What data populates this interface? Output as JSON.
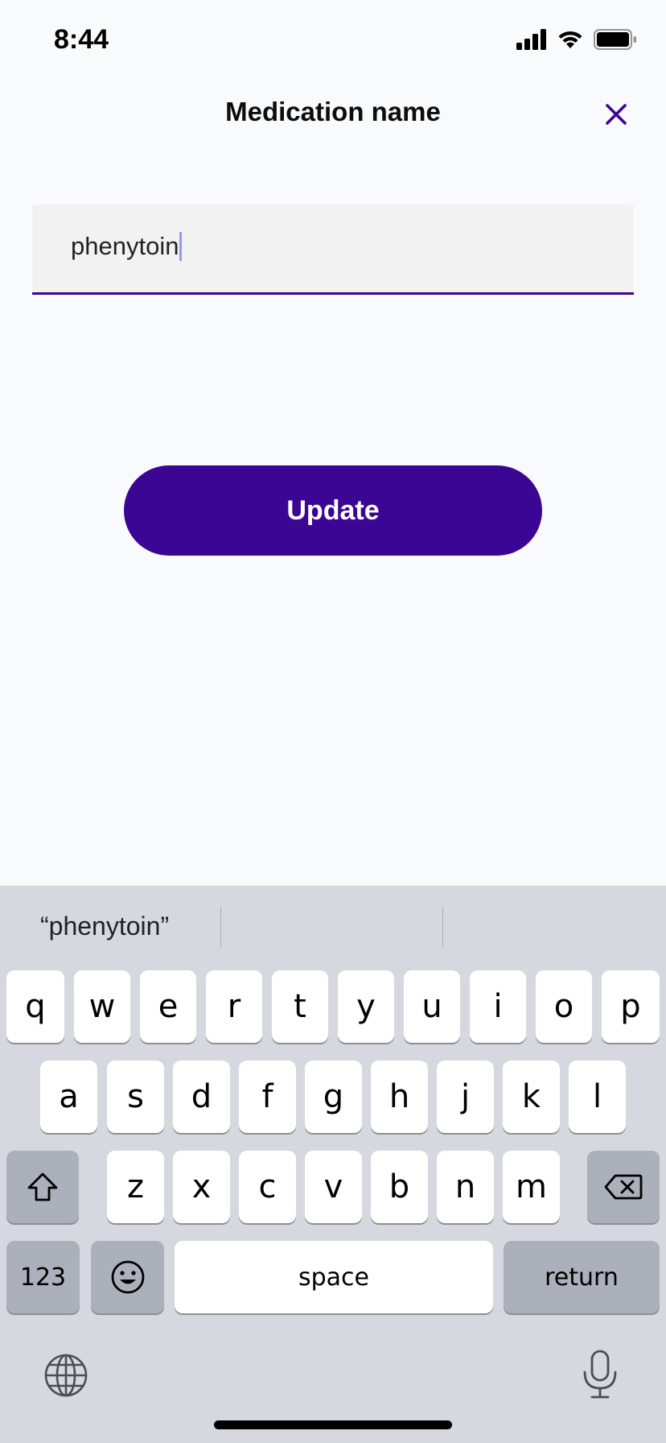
{
  "status": {
    "time": "8:44",
    "icons": [
      "signal-icon",
      "wifi-icon",
      "battery-icon"
    ]
  },
  "header": {
    "title": "Medication name",
    "close_icon": "close-icon"
  },
  "field": {
    "value": "phenytoin"
  },
  "button": {
    "update_label": "Update"
  },
  "keyboard": {
    "suggestions": [
      "“phenytoin”",
      "",
      ""
    ],
    "row1": [
      "q",
      "w",
      "e",
      "r",
      "t",
      "y",
      "u",
      "i",
      "o",
      "p"
    ],
    "row2": [
      "a",
      "s",
      "d",
      "f",
      "g",
      "h",
      "j",
      "k",
      "l"
    ],
    "row3": [
      "z",
      "x",
      "c",
      "v",
      "b",
      "n",
      "m"
    ],
    "numbers_label": "123",
    "space_label": "space",
    "return_label": "return",
    "icons": [
      "shift-icon",
      "backspace-icon",
      "emoji-icon",
      "globe-icon",
      "microphone-icon"
    ]
  },
  "colors": {
    "accent": "#3c0694",
    "background": "#f9fafc",
    "keyboard_bg": "#d5d8de"
  }
}
